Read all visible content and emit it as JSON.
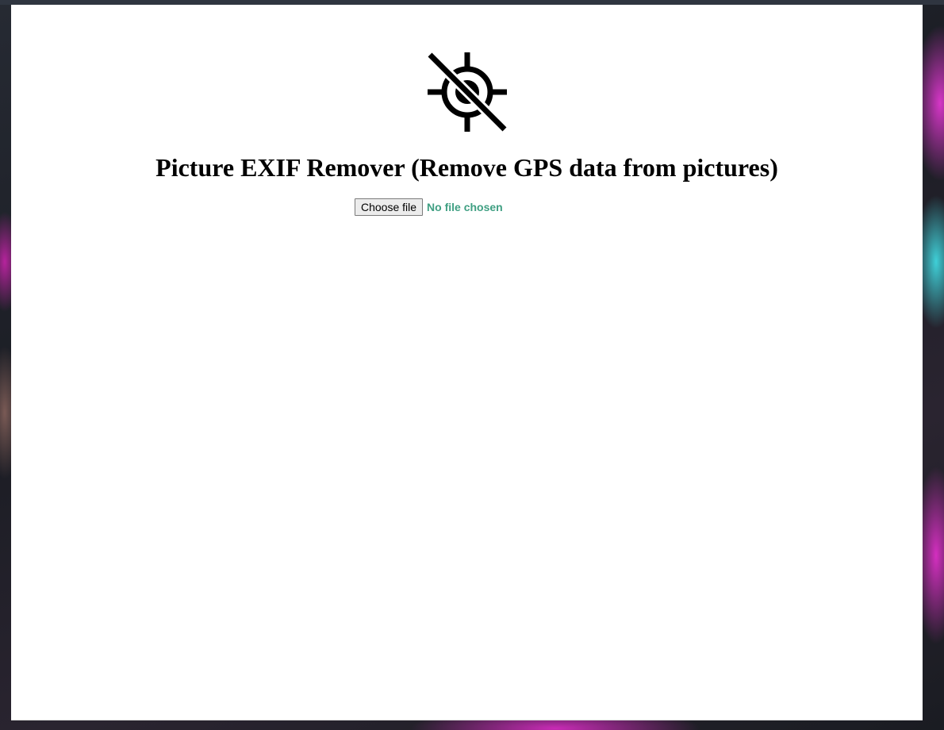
{
  "page": {
    "title": "Picture EXIF Remover (Remove GPS data from pictures)"
  },
  "logo": {
    "icon": "gps-off-icon"
  },
  "file_input": {
    "button_label": "Choose file",
    "status_text": "No file chosen"
  },
  "colors": {
    "status_text": "#3f9f82",
    "page_background": "#ffffff",
    "title_text": "#000000"
  }
}
